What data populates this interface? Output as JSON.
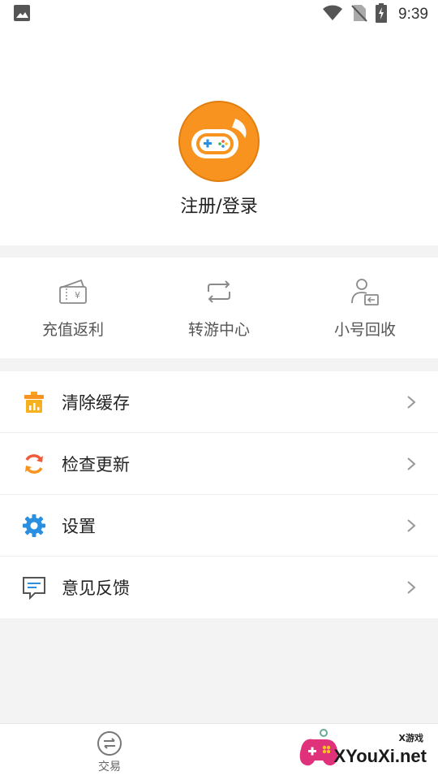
{
  "status_bar": {
    "time": "9:39"
  },
  "profile": {
    "login_label": "注册/登录"
  },
  "quick_actions": [
    {
      "label": "充值返利",
      "icon": "recharge-rebate-icon"
    },
    {
      "label": "转游中心",
      "icon": "transfer-game-icon"
    },
    {
      "label": "小号回收",
      "icon": "account-recycle-icon"
    }
  ],
  "menu": [
    {
      "label": "清除缓存",
      "icon": "clear-cache-icon"
    },
    {
      "label": "检查更新",
      "icon": "check-update-icon"
    },
    {
      "label": "设置",
      "icon": "settings-icon"
    },
    {
      "label": "意见反馈",
      "icon": "feedback-icon"
    }
  ],
  "bottom_nav": {
    "trade_label": "交易"
  },
  "watermark": {
    "small": "X游戏",
    "big": "XYouXi.net"
  },
  "colors": {
    "accent_orange": "#f7931e",
    "icon_gray": "#8a8a8a",
    "settings_blue": "#2a8fe0",
    "update_red": "#f05a3a"
  }
}
